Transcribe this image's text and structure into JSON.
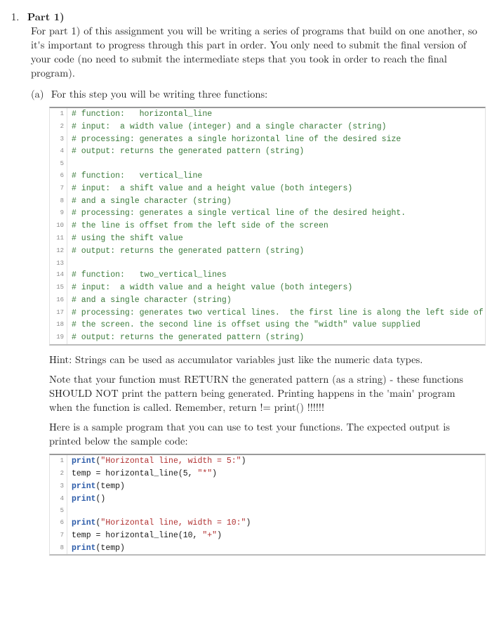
{
  "item_number": "1.",
  "part_title": "Part 1)",
  "intro_para": "For part 1) of this assignment you will be writing a series of programs that build on one another, so it's important to progress through this part in order. You only need to submit the final version of your code (no need to submit the intermediate steps that you took in order to reach the final program).",
  "sub_a_label": "(a)",
  "sub_a_text": "For this step you will be writing three functions:",
  "code1": {
    "lines": [
      {
        "n": "1",
        "segs": [
          {
            "cls": "c-comment",
            "t": "# function:   horizontal_line"
          }
        ]
      },
      {
        "n": "2",
        "segs": [
          {
            "cls": "c-comment",
            "t": "# input:  a width value (integer) and a single character (string)"
          }
        ]
      },
      {
        "n": "3",
        "segs": [
          {
            "cls": "c-comment",
            "t": "# processing: generates a single horizontal line of the desired size"
          }
        ]
      },
      {
        "n": "4",
        "segs": [
          {
            "cls": "c-comment",
            "t": "# output: returns the generated pattern (string)"
          }
        ]
      },
      {
        "n": "5",
        "segs": [
          {
            "cls": "",
            "t": ""
          }
        ]
      },
      {
        "n": "6",
        "segs": [
          {
            "cls": "c-comment",
            "t": "# function:   vertical_line"
          }
        ]
      },
      {
        "n": "7",
        "segs": [
          {
            "cls": "c-comment",
            "t": "# input:  a shift value and a height value (both integers)"
          }
        ]
      },
      {
        "n": "8",
        "segs": [
          {
            "cls": "c-comment",
            "t": "# and a single character (string)"
          }
        ]
      },
      {
        "n": "9",
        "segs": [
          {
            "cls": "c-comment",
            "t": "# processing: generates a single vertical line of the desired height."
          }
        ]
      },
      {
        "n": "10",
        "segs": [
          {
            "cls": "c-comment",
            "t": "# the line is offset from the left side of the screen"
          }
        ]
      },
      {
        "n": "11",
        "segs": [
          {
            "cls": "c-comment",
            "t": "# using the shift value"
          }
        ]
      },
      {
        "n": "12",
        "segs": [
          {
            "cls": "c-comment",
            "t": "# output: returns the generated pattern (string)"
          }
        ]
      },
      {
        "n": "13",
        "segs": [
          {
            "cls": "",
            "t": ""
          }
        ]
      },
      {
        "n": "14",
        "segs": [
          {
            "cls": "c-comment",
            "t": "# function:   two_vertical_lines"
          }
        ]
      },
      {
        "n": "15",
        "segs": [
          {
            "cls": "c-comment",
            "t": "# input:  a width value and a height value (both integers)"
          }
        ]
      },
      {
        "n": "16",
        "segs": [
          {
            "cls": "c-comment",
            "t": "# and a single character (string)"
          }
        ]
      },
      {
        "n": "17",
        "segs": [
          {
            "cls": "c-comment",
            "t": "# processing: generates two vertical lines.  the first line is along the left side of"
          }
        ]
      },
      {
        "n": "18",
        "segs": [
          {
            "cls": "c-comment",
            "t": "# the screen. the second line is offset using the \"width\" value supplied"
          }
        ]
      },
      {
        "n": "19",
        "segs": [
          {
            "cls": "c-comment",
            "t": "# output: returns the generated pattern (string)"
          }
        ]
      }
    ]
  },
  "hint_text": "Hint: Strings can be used as accumulator variables just like the numeric data types.",
  "note_text": "Note that your function must RETURN the generated pattern (as a string) - these functions SHOULD NOT print the pattern being generated. Printing happens in the 'main' program when the function is called. Remember, return != print() !!!!!!",
  "sample_text": "Here is a sample program that you can use to test your functions. The expected output is printed below the sample code:",
  "code2": {
    "lines": [
      {
        "n": "1",
        "segs": [
          {
            "cls": "c-kw",
            "t": "print"
          },
          {
            "cls": "",
            "t": "("
          },
          {
            "cls": "c-str",
            "t": "\"Horizontal line, width = 5:\""
          },
          {
            "cls": "",
            "t": ")"
          }
        ]
      },
      {
        "n": "2",
        "segs": [
          {
            "cls": "",
            "t": "temp = horizontal_line(5, "
          },
          {
            "cls": "c-str",
            "t": "\"*\""
          },
          {
            "cls": "",
            "t": ")"
          }
        ]
      },
      {
        "n": "3",
        "segs": [
          {
            "cls": "c-kw",
            "t": "print"
          },
          {
            "cls": "",
            "t": "(temp)"
          }
        ]
      },
      {
        "n": "4",
        "segs": [
          {
            "cls": "c-kw",
            "t": "print"
          },
          {
            "cls": "",
            "t": "()"
          }
        ]
      },
      {
        "n": "5",
        "segs": [
          {
            "cls": "",
            "t": ""
          }
        ]
      },
      {
        "n": "6",
        "segs": [
          {
            "cls": "c-kw",
            "t": "print"
          },
          {
            "cls": "",
            "t": "("
          },
          {
            "cls": "c-str",
            "t": "\"Horizontal line, width = 10:\""
          },
          {
            "cls": "",
            "t": ")"
          }
        ]
      },
      {
        "n": "7",
        "segs": [
          {
            "cls": "",
            "t": "temp = horizontal_line(10, "
          },
          {
            "cls": "c-str",
            "t": "\"+\""
          },
          {
            "cls": "",
            "t": ")"
          }
        ]
      },
      {
        "n": "8",
        "segs": [
          {
            "cls": "c-kw",
            "t": "print"
          },
          {
            "cls": "",
            "t": "(temp)"
          }
        ]
      }
    ]
  }
}
